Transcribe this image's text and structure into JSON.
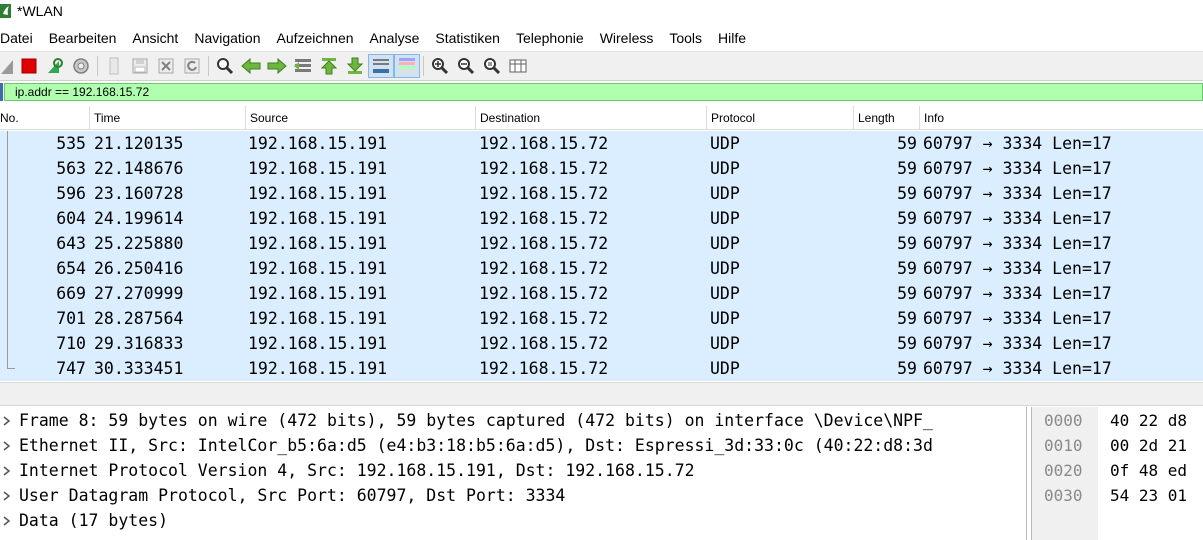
{
  "window": {
    "title": "*WLAN"
  },
  "menu": [
    "Datei",
    "Bearbeiten",
    "Ansicht",
    "Navigation",
    "Aufzeichnen",
    "Analyse",
    "Statistiken",
    "Telephonie",
    "Wireless",
    "Tools",
    "Hilfe"
  ],
  "toolbar": {
    "icons": [
      "shark-fin-start-icon",
      "stop-icon",
      "restart-capture-icon",
      "capture-options-gear-icon",
      "open-file-icon",
      "save-file-icon",
      "close-file-icon",
      "reload-icon",
      "find-packet-icon",
      "go-back-icon",
      "go-forward-icon",
      "go-to-packet-icon",
      "first-packet-icon",
      "last-packet-icon",
      "auto-scroll-icon",
      "colorize-icon",
      "zoom-in-icon",
      "zoom-out-icon",
      "zoom-normal-icon",
      "resize-columns-icon"
    ]
  },
  "filter": {
    "value": "ip.addr == 192.168.15.72"
  },
  "packet_list": {
    "columns": [
      "No.",
      "Time",
      "Source",
      "Destination",
      "Protocol",
      "Length",
      "Info"
    ],
    "rows": [
      {
        "no": "535",
        "time": "21.120135",
        "src": "192.168.15.191",
        "dst": "192.168.15.72",
        "proto": "UDP",
        "len": "59",
        "info": "60797 → 3334 Len=17"
      },
      {
        "no": "563",
        "time": "22.148676",
        "src": "192.168.15.191",
        "dst": "192.168.15.72",
        "proto": "UDP",
        "len": "59",
        "info": "60797 → 3334 Len=17"
      },
      {
        "no": "596",
        "time": "23.160728",
        "src": "192.168.15.191",
        "dst": "192.168.15.72",
        "proto": "UDP",
        "len": "59",
        "info": "60797 → 3334 Len=17"
      },
      {
        "no": "604",
        "time": "24.199614",
        "src": "192.168.15.191",
        "dst": "192.168.15.72",
        "proto": "UDP",
        "len": "59",
        "info": "60797 → 3334 Len=17"
      },
      {
        "no": "643",
        "time": "25.225880",
        "src": "192.168.15.191",
        "dst": "192.168.15.72",
        "proto": "UDP",
        "len": "59",
        "info": "60797 → 3334 Len=17"
      },
      {
        "no": "654",
        "time": "26.250416",
        "src": "192.168.15.191",
        "dst": "192.168.15.72",
        "proto": "UDP",
        "len": "59",
        "info": "60797 → 3334 Len=17"
      },
      {
        "no": "669",
        "time": "27.270999",
        "src": "192.168.15.191",
        "dst": "192.168.15.72",
        "proto": "UDP",
        "len": "59",
        "info": "60797 → 3334 Len=17"
      },
      {
        "no": "701",
        "time": "28.287564",
        "src": "192.168.15.191",
        "dst": "192.168.15.72",
        "proto": "UDP",
        "len": "59",
        "info": "60797 → 3334 Len=17"
      },
      {
        "no": "710",
        "time": "29.316833",
        "src": "192.168.15.191",
        "dst": "192.168.15.72",
        "proto": "UDP",
        "len": "59",
        "info": "60797 → 3334 Len=17"
      },
      {
        "no": "747",
        "time": "30.333451",
        "src": "192.168.15.191",
        "dst": "192.168.15.72",
        "proto": "UDP",
        "len": "59",
        "info": "60797 → 3334 Len=17"
      }
    ]
  },
  "details": [
    "Frame 8: 59 bytes on wire (472 bits), 59 bytes captured (472 bits) on interface \\Device\\NPF_",
    "Ethernet II, Src: IntelCor_b5:6a:d5 (e4:b3:18:b5:6a:d5), Dst: Espressi_3d:33:0c (40:22:d8:3d",
    "Internet Protocol Version 4, Src: 192.168.15.191, Dst: 192.168.15.72",
    "User Datagram Protocol, Src Port: 60797, Dst Port: 3334",
    "Data (17 bytes)"
  ],
  "hex": {
    "offsets": [
      "0000",
      "0010",
      "0020",
      "0030"
    ],
    "bytes": [
      "40 22 d8",
      "00 2d 21",
      "0f 48 ed",
      "54 23 01"
    ]
  },
  "colors": {
    "row_bg": "#daeeff",
    "filter_bg": "#afffaf",
    "toolbar_bg": "#f0f0f0"
  }
}
